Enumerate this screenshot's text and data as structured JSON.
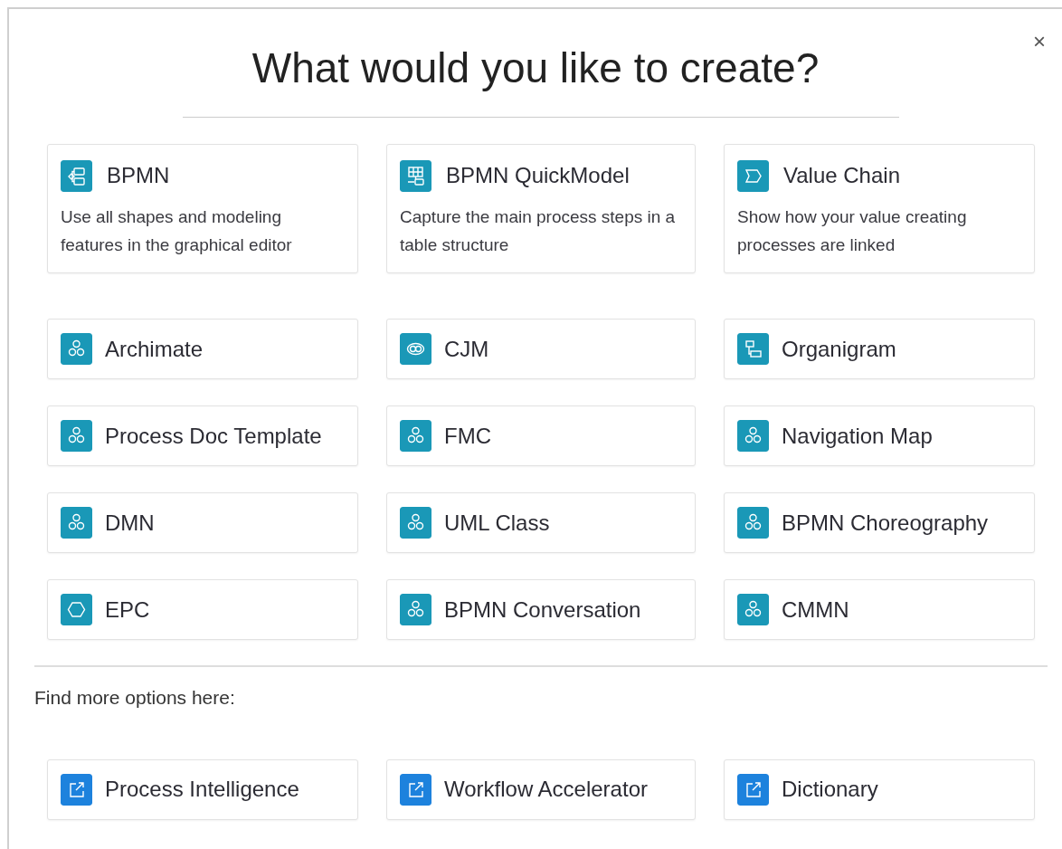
{
  "dialog": {
    "title": "What would you like to create?",
    "close": "×"
  },
  "featured": [
    {
      "title": "BPMN",
      "description": "Use all shapes and modeling features in the graphical editor",
      "kind": "process"
    },
    {
      "title": "BPMN QuickModel",
      "description": "Capture the main process steps in a table structure",
      "kind": "table"
    },
    {
      "title": "Value Chain",
      "description": "Show how your value creating processes are linked",
      "kind": "chevron"
    }
  ],
  "options": [
    {
      "title": "Archimate",
      "kind": "cluster"
    },
    {
      "title": "CJM",
      "kind": "cjm"
    },
    {
      "title": "Organigram",
      "kind": "org"
    },
    {
      "title": "Process Doc Template",
      "kind": "cluster"
    },
    {
      "title": "FMC",
      "kind": "cluster"
    },
    {
      "title": "Navigation Map",
      "kind": "cluster"
    },
    {
      "title": "DMN",
      "kind": "cluster"
    },
    {
      "title": "UML Class",
      "kind": "cluster"
    },
    {
      "title": "BPMN Choreography",
      "kind": "cluster"
    },
    {
      "title": "EPC",
      "kind": "hexagon"
    },
    {
      "title": "BPMN Conversation",
      "kind": "cluster"
    },
    {
      "title": "CMMN",
      "kind": "cluster"
    }
  ],
  "more": {
    "label": "Find more options here:",
    "links": [
      {
        "title": "Process Intelligence",
        "kind": "external"
      },
      {
        "title": "Workflow Accelerator",
        "kind": "external"
      },
      {
        "title": "Dictionary",
        "kind": "external"
      }
    ]
  }
}
